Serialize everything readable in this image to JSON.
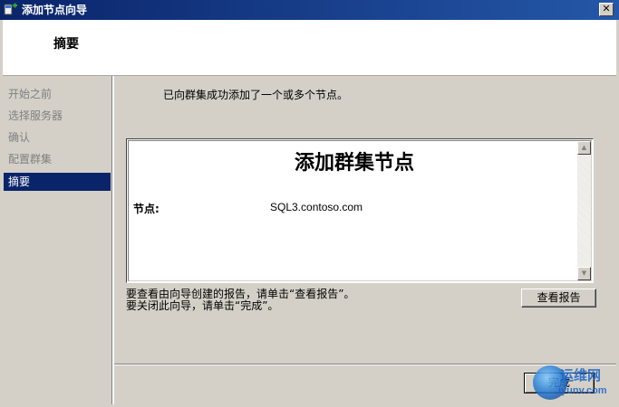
{
  "window": {
    "title": "添加节点向导",
    "close_glyph": "✕"
  },
  "header": {
    "title": "摘要"
  },
  "sidebar": {
    "items": [
      {
        "label": "开始之前",
        "active": false
      },
      {
        "label": "选择服务器",
        "active": false
      },
      {
        "label": "确认",
        "active": false
      },
      {
        "label": "配置群集",
        "active": false
      },
      {
        "label": "摘要",
        "active": true
      }
    ]
  },
  "main": {
    "success_message": "已向群集成功添加了一个或多个节点。",
    "report": {
      "title": "添加群集节点",
      "label": "节点:",
      "value": "SQL3.contoso.com"
    },
    "hint_view_report": "要查看由向导创建的报告，请单击“查看报告”。",
    "hint_close": "要关闭此向导，请单击“完成”。",
    "view_report_label": "查看报告",
    "finish_label": "完成"
  },
  "watermark": {
    "text": "运维网",
    "url": "iyunv.com"
  },
  "colors": {
    "titlebar": "#0a246a",
    "active_nav": "#0a246a",
    "dialog_bg": "#d4d0c8"
  },
  "icons": {
    "app": "wizard-node-icon",
    "close": "close-icon",
    "scroll_up": "scroll-up-arrow-icon",
    "scroll_down": "scroll-down-arrow-icon"
  }
}
